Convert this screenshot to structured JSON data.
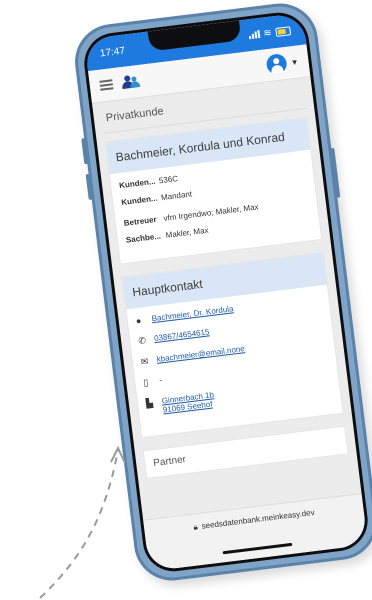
{
  "status": {
    "time": "17:47"
  },
  "app": {
    "page_heading": "Privatkunde"
  },
  "customer_card": {
    "title": "Bachmeier, Kordula und Konrad",
    "fields": [
      {
        "key": "Kunden...",
        "value": "536C"
      },
      {
        "key": "Kunden...",
        "value": "Mandant"
      },
      {
        "key": "Betreuer",
        "value": "vfm Irgendwo; Makler, Max"
      },
      {
        "key": "Sachbe...",
        "value": "Makler, Max"
      }
    ]
  },
  "contact_card": {
    "title": "Hauptkontakt",
    "name": "Bachmeier, Dr. Kordula",
    "phone": "03867/4654615",
    "email": "kbachmeier@email.none",
    "mobile": "-",
    "address_line1": "Ginnerbach 1b",
    "address_line2": "91069 Seehof"
  },
  "partner": {
    "label": "Partner"
  },
  "browser": {
    "url": "seedsdatenbank.meinkeasy.dev"
  },
  "icons": [
    "menu-icon",
    "users-icon",
    "avatar-icon",
    "user-icon",
    "phone-icon",
    "email-icon",
    "mobile-icon",
    "building-icon",
    "lock-icon"
  ],
  "colors": {
    "statusbar": "#1f7ae0",
    "card_header": "#d9e6f5",
    "link": "#1f5aa8",
    "phone_frame": "#7fa4c8"
  }
}
